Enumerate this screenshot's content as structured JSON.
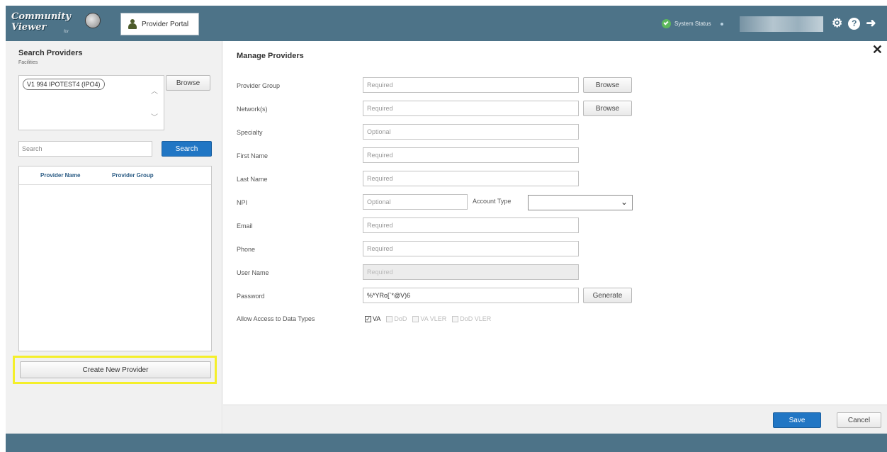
{
  "header": {
    "logo_line1": "Community",
    "logo_line2": "Viewer",
    "logo_sub": "for",
    "portal_tab": "Provider Portal",
    "system_status": "System Status",
    "icons": [
      "settings-gear-icon",
      "help-icon",
      "logout-icon"
    ],
    "colors": {
      "bar": "#4d7388",
      "status_ok": "#5cb85c"
    }
  },
  "sidebar": {
    "title": "Search Providers",
    "facilities_label": "Facilities",
    "facility_chip": "V1 994 IPOTEST4 (IPO4)",
    "browse_label": "Browse",
    "search_placeholder": "Search",
    "search_button": "Search",
    "table_headers": [
      "Provider Name",
      "Provider Group"
    ],
    "create_button": "Create New Provider",
    "highlight_color": "#f4ef2a"
  },
  "main": {
    "title": "Manage Providers",
    "close_symbol": "✕",
    "fields": {
      "provider_group": {
        "label": "Provider Group",
        "placeholder": "Required",
        "browse": "Browse"
      },
      "networks": {
        "label": "Network(s)",
        "placeholder": "Required",
        "browse": "Browse"
      },
      "specialty": {
        "label": "Specialty",
        "placeholder": "Optional"
      },
      "first_name": {
        "label": "First Name",
        "placeholder": "Required"
      },
      "last_name": {
        "label": "Last Name",
        "placeholder": "Required"
      },
      "npi": {
        "label": "NPI",
        "placeholder": "Optional"
      },
      "account_type": {
        "label": "Account Type",
        "value": ""
      },
      "email": {
        "label": "Email",
        "placeholder": "Required"
      },
      "phone": {
        "label": "Phone",
        "placeholder": "Required"
      },
      "user_name": {
        "label": "User Name",
        "placeholder": "Required"
      },
      "password": {
        "label": "Password",
        "value": "%*YRo[`*@V)6",
        "generate": "Generate"
      }
    },
    "data_types": {
      "label": "Allow Access to Data Types",
      "options": [
        {
          "label": "VA",
          "checked": true
        },
        {
          "label": "DoD",
          "checked": false
        },
        {
          "label": "VA VLER",
          "checked": false
        },
        {
          "label": "DoD VLER",
          "checked": false
        }
      ]
    },
    "save_button": "Save",
    "cancel_button": "Cancel",
    "accent": "#2176c4"
  }
}
